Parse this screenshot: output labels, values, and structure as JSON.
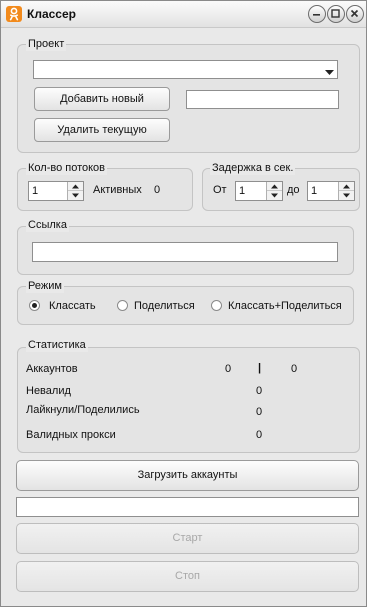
{
  "window": {
    "title": "Классер"
  },
  "project": {
    "legend": "Проект",
    "select_value": "",
    "add_button": "Добавить новый",
    "new_name_value": "",
    "delete_button": "Удалить текущую"
  },
  "threads": {
    "legend": "Кол-во потоков",
    "value": "1",
    "active_label": "Активных",
    "active_count": "0"
  },
  "delay": {
    "legend": "Задержка в сек.",
    "from_label": "От",
    "from_value": "1",
    "to_label": "до",
    "to_value": "1"
  },
  "link": {
    "legend": "Ссылка",
    "value": ""
  },
  "mode": {
    "legend": "Режим",
    "options": [
      "Классать",
      "Поделиться",
      "Классать+Поделиться"
    ],
    "selected": "Классать"
  },
  "stats": {
    "legend": "Статистика",
    "accounts_label": "Аккаунтов",
    "accounts_value_1": "0",
    "separator": "|",
    "accounts_value_2": "0",
    "invalid_label": "Невалид",
    "invalid_value": "0",
    "liked_label": "Лайкнули/Поделились",
    "liked_value": "0",
    "proxy_label": "Валидных прокси",
    "proxy_value": "0"
  },
  "actions": {
    "load_accounts": "Загрузить аккаунты",
    "log_value": "",
    "start": "Старт",
    "stop": "Стоп"
  }
}
